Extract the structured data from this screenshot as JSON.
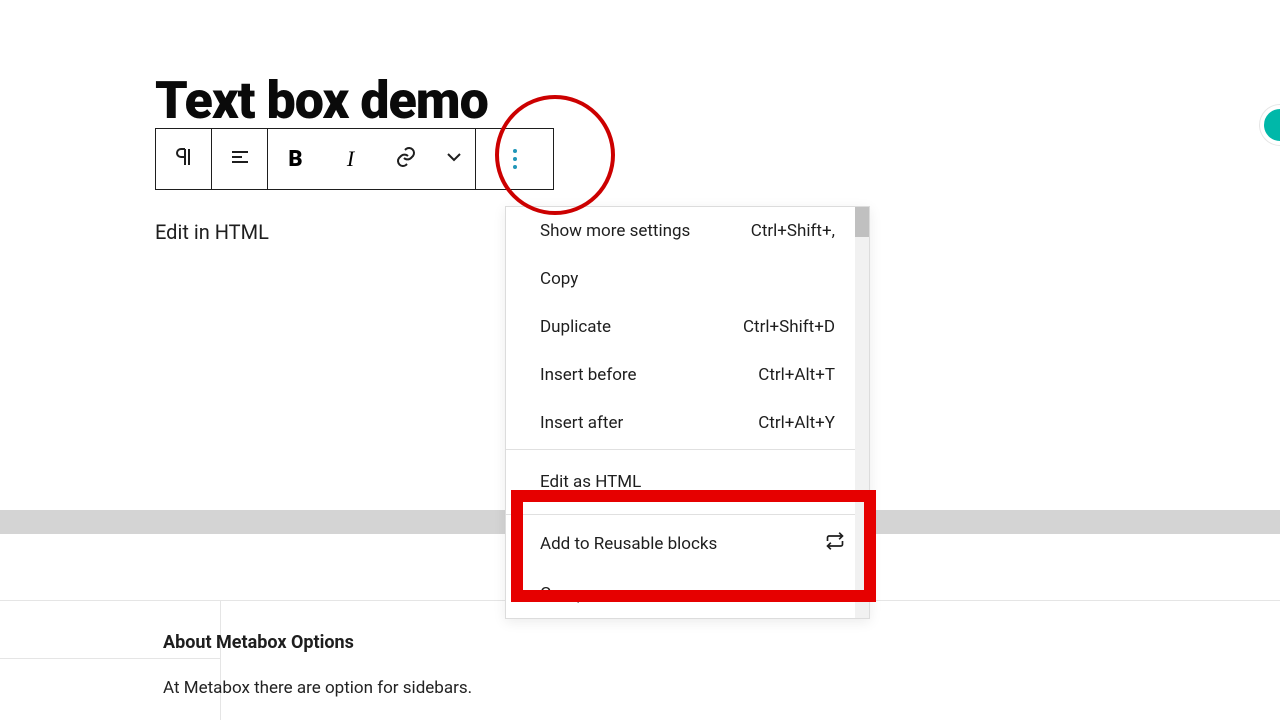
{
  "page": {
    "title": "Text box demo",
    "content_line": "Edit in HTML"
  },
  "toolbar": {
    "items": [
      "paragraph",
      "align",
      "bold",
      "italic",
      "link",
      "more-format",
      "more-options"
    ]
  },
  "dropdown": {
    "items": [
      {
        "label": "Show more settings",
        "shortcut": "Ctrl+Shift+,"
      },
      {
        "label": "Copy",
        "shortcut": ""
      },
      {
        "label": "Duplicate",
        "shortcut": "Ctrl+Shift+D"
      },
      {
        "label": "Insert before",
        "shortcut": "Ctrl+Alt+T"
      },
      {
        "label": "Insert after",
        "shortcut": "Ctrl+Alt+Y"
      },
      {
        "label": "Edit as HTML",
        "shortcut": ""
      },
      {
        "label": "Add to Reusable blocks",
        "shortcut": "",
        "icon": "swap"
      },
      {
        "label": "Group",
        "shortcut": ""
      }
    ]
  },
  "metabox": {
    "heading": "About Metabox Options",
    "desc": "At Metabox there are option for sidebars."
  },
  "annotation_colors": {
    "circle": "#cc0000",
    "rect": "#e60000"
  }
}
